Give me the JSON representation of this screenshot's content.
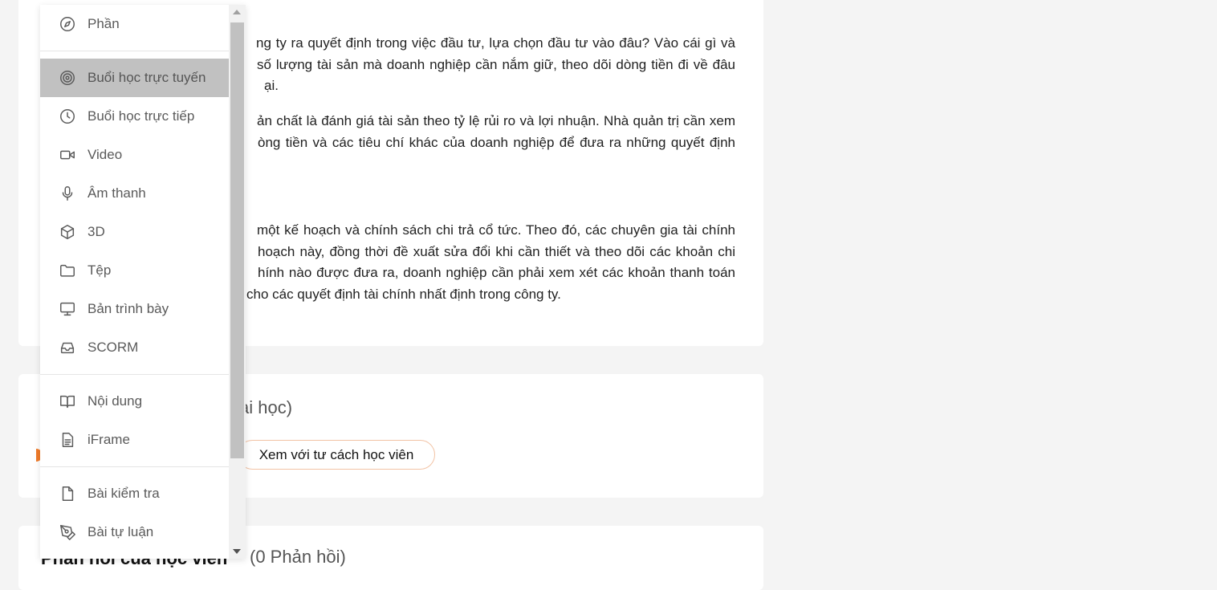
{
  "content": {
    "p1_lines": [
      "ng ty ra quyết định trong việc đầu tư, lựa chọn đầu tư vào đâu? Vào cái gì và",
      "số lượng tài sản mà doanh nghiệp cần nắm giữ, theo dõi dòng tiền đi về đâu",
      "ại."
    ],
    "p2_lines": [
      "ản chất là đánh giá tài sản theo tỷ lệ rủi ro và lợi nhuận. Nhà quản trị cần xem",
      "òng tiền và các tiêu chí khác của doanh nghiệp để đưa ra những quyết định"
    ],
    "p3_lines": [
      "một kế hoạch và chính sách chi trả cổ tức. Theo đó, các chuyên gia tài chính",
      "hoạch này, đồng thời đề xuất sửa đổi khi cần thiết và theo dõi các khoản chi",
      "hính nào được đưa ra, doanh nghiệp cần phải xem xét các khoản thanh toán",
      "cho các quyết định tài chính nhất định trong công ty."
    ]
  },
  "lesson": {
    "title_fragment": "ài học)",
    "view_as_student": "Xem với tư cách học viên"
  },
  "feedback": {
    "title": "Phản hồi của học viên",
    "count": "(0 Phản hồi)"
  },
  "menu": {
    "groups": [
      [
        {
          "label": "Phần",
          "icon": "compass-icon"
        }
      ],
      [
        {
          "label": "Buổi học trực tuyến",
          "icon": "target-icon",
          "active": true
        },
        {
          "label": "Buổi học trực tiếp",
          "icon": "clock-icon"
        },
        {
          "label": "Video",
          "icon": "video-icon"
        },
        {
          "label": "Âm thanh",
          "icon": "microphone-icon"
        },
        {
          "label": "3D",
          "icon": "cube-icon"
        },
        {
          "label": "Tệp",
          "icon": "folder-icon"
        },
        {
          "label": "Bản trình bày",
          "icon": "monitor-icon"
        },
        {
          "label": "SCORM",
          "icon": "inbox-icon"
        }
      ],
      [
        {
          "label": "Nội dung",
          "icon": "book-icon"
        },
        {
          "label": "iFrame",
          "icon": "document-icon"
        }
      ],
      [
        {
          "label": "Bài kiểm tra",
          "icon": "file-icon"
        },
        {
          "label": "Bài tự luận",
          "icon": "pen-tool-icon"
        }
      ]
    ]
  }
}
